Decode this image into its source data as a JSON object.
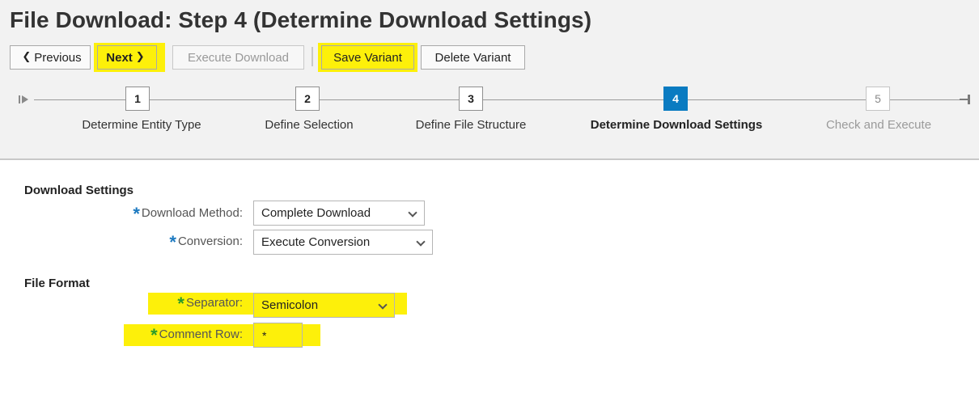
{
  "page": {
    "title": "File Download: Step 4  (Determine Download Settings)"
  },
  "toolbar": {
    "previous_label": "Previous",
    "next_label": "Next",
    "execute_label": "Execute Download",
    "save_variant_label": "Save Variant",
    "delete_variant_label": "Delete Variant",
    "highlight_color": "#fdf00a"
  },
  "roadmap": {
    "active_color": "#0a7bc1",
    "steps": [
      {
        "number": "1",
        "label": "Determine Entity Type",
        "state": "done"
      },
      {
        "number": "2",
        "label": "Define Selection",
        "state": "done"
      },
      {
        "number": "3",
        "label": "Define File Structure",
        "state": "done"
      },
      {
        "number": "4",
        "label": "Determine Download Settings",
        "state": "active"
      },
      {
        "number": "5",
        "label": "Check and Execute",
        "state": "inactive"
      }
    ]
  },
  "download_settings": {
    "title": "Download Settings",
    "download_method": {
      "label": "Download Method:",
      "value": "Complete Download"
    },
    "conversion": {
      "label": "Conversion:",
      "value": "Execute Conversion"
    }
  },
  "file_format": {
    "title": "File Format",
    "separator": {
      "label": "Separator:",
      "value": "Semicolon"
    },
    "comment_row": {
      "label": "Comment Row:",
      "value": "*"
    }
  },
  "required_marker": "*"
}
